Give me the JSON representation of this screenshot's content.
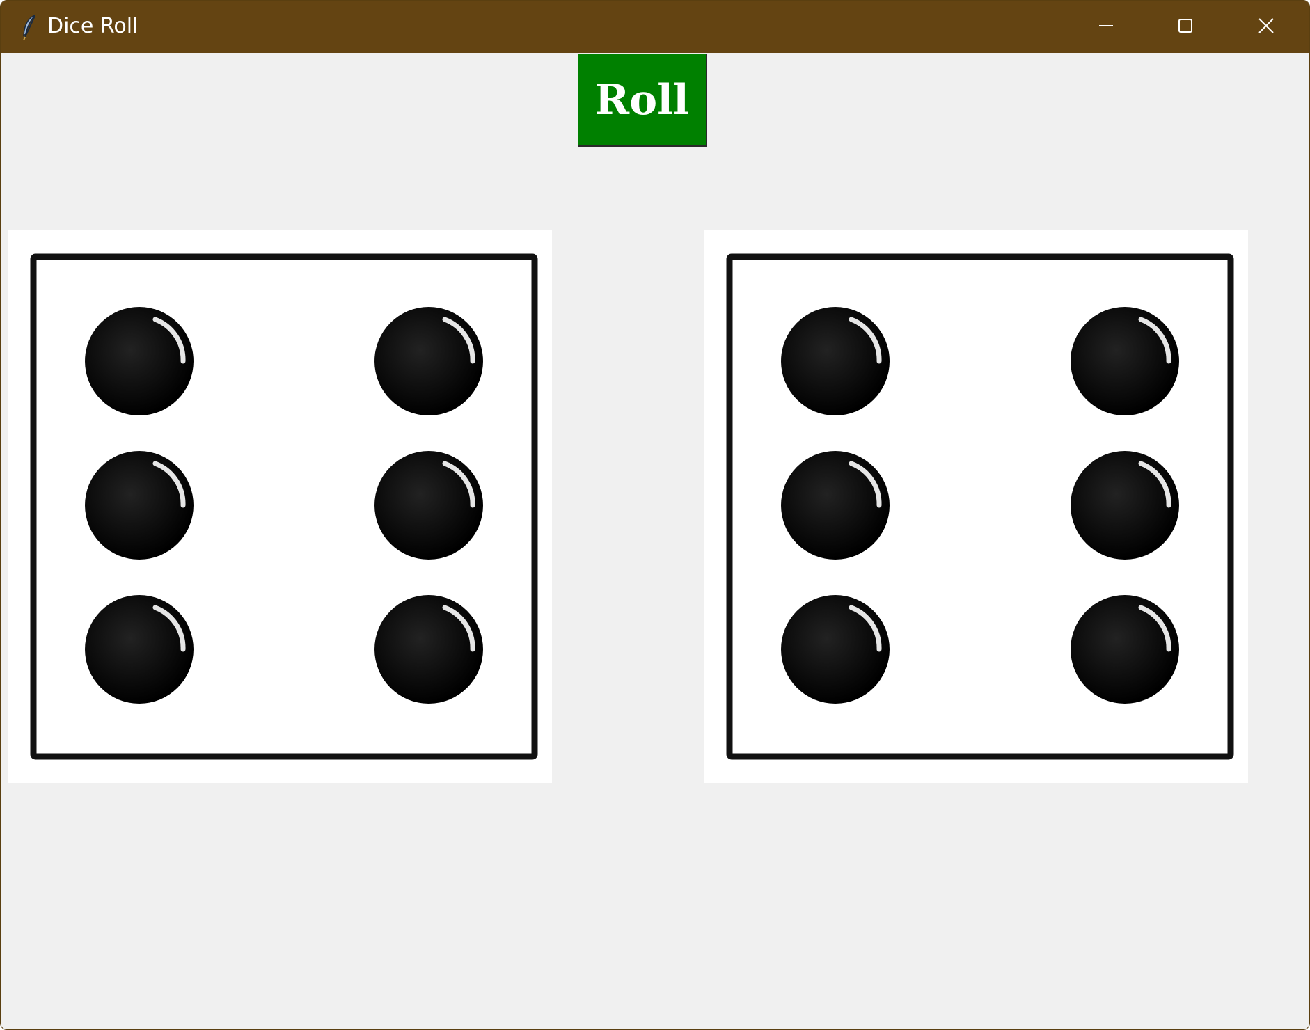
{
  "window": {
    "title": "Dice Roll",
    "app_icon": "feather-icon",
    "controls": [
      "minimize-icon",
      "maximize-icon",
      "close-icon"
    ]
  },
  "roll_button": {
    "label": "Roll",
    "background": "#008000",
    "text_color": "#ffffff"
  },
  "dice": [
    {
      "face_value": 6
    },
    {
      "face_value": 6
    }
  ],
  "colors": {
    "titlebar": "#644412",
    "window_background": "#f0f0f0"
  }
}
